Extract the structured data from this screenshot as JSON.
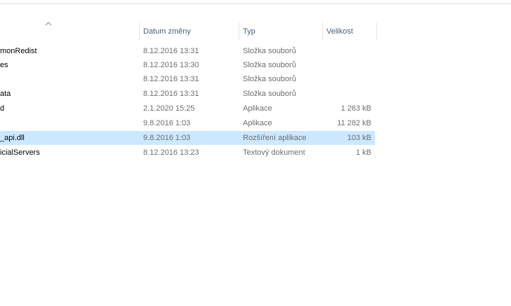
{
  "header": {
    "name_label": "",
    "date_label": "Datum změny",
    "type_label": "Typ",
    "size_label": "Velikost",
    "sort_icon": "chevron-up-icon"
  },
  "files": [
    {
      "name": "monRedist",
      "date": "8.12.2016 13:31",
      "type": "Složka souborů",
      "size": ""
    },
    {
      "name": "es",
      "date": "8.12.2016 13:30",
      "type": "Složka souborů",
      "size": ""
    },
    {
      "name": "",
      "date": "8.12.2016 13:31",
      "type": "Složka souborů",
      "size": ""
    },
    {
      "name": "ata",
      "date": "8.12.2016 13:31",
      "type": "Složka souborů",
      "size": ""
    },
    {
      "name": "d",
      "date": "2.1.2020 15:25",
      "type": "Aplikace",
      "size": "1 263 kB"
    },
    {
      "name": "",
      "date": "9.8.2016 1:03",
      "type": "Aplikace",
      "size": "11 282 kB"
    },
    {
      "name": "_api.dll",
      "date": "9.8.2016 1:03",
      "type": "Rozšíření aplikace",
      "size": "103 kB",
      "selected": true
    },
    {
      "name": "icialServers",
      "date": "8.12.2016 13:23",
      "type": "Textový dokument",
      "size": "1 kB"
    }
  ],
  "colors": {
    "selection": "#cce8ff",
    "header_text": "#4c607a",
    "secondary_text": "#6d6d6d"
  }
}
